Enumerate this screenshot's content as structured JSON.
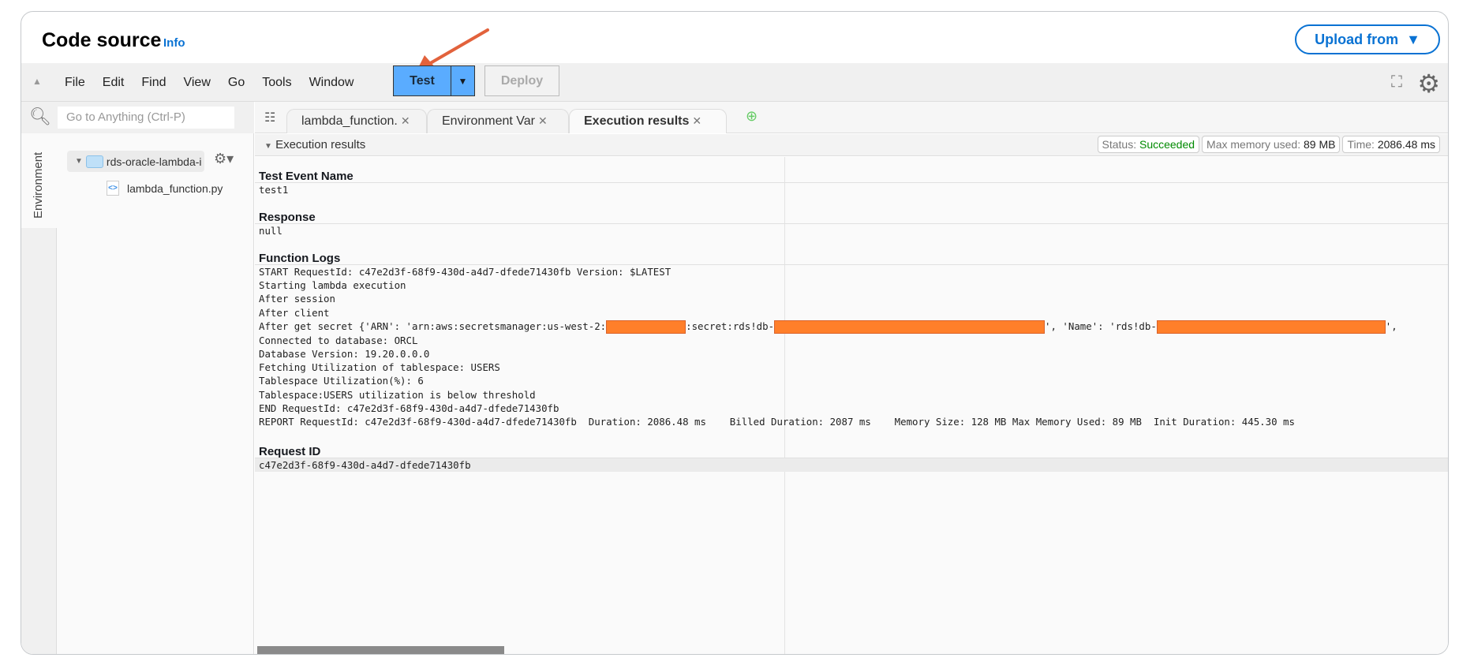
{
  "header": {
    "title": "Code source",
    "info": "Info",
    "upload": "Upload from",
    "upload_caret": "▼"
  },
  "toolbar": {
    "menu": [
      "File",
      "Edit",
      "Find",
      "View",
      "Go",
      "Tools",
      "Window"
    ],
    "test": "Test",
    "deploy": "Deploy"
  },
  "sidebar": {
    "search_placeholder": "Go to Anything (Ctrl-P)",
    "env_tab": "Environment",
    "folder": "rds-oracle-lambda-i",
    "file": "lambda_function.py"
  },
  "tabs": [
    {
      "label": "lambda_function."
    },
    {
      "label": "Environment Var"
    },
    {
      "label": "Execution results"
    }
  ],
  "results": {
    "title": "Execution results",
    "status_label": "Status:",
    "status": "Succeeded",
    "status_color": "#008a00",
    "memory_label": "Max memory used:",
    "memory": "89 MB",
    "time_label": "Time:",
    "time": "2086.48 ms",
    "test_event_name_label": "Test Event Name",
    "test_event_name": "test1",
    "response_label": "Response",
    "response": "null",
    "logs_label": "Function Logs",
    "logs_before": [
      "START RequestId: c47e2d3f-68f9-430d-a4d7-dfede71430fb Version: $LATEST",
      "Starting lambda execution",
      "After session",
      "After client"
    ],
    "secret_line": {
      "p1": "After get secret {'ARN': 'arn:aws:secretsmanager:us-west-2:",
      "p2": ":secret:rds!db-",
      "p3": "', 'Name': 'rds!db-",
      "p4": "',",
      "redaction_color": "#ff7f2a"
    },
    "logs_after": [
      "Connected to database: ORCL",
      "Database Version: 19.20.0.0.0",
      "Fetching Utilization of tablespace: USERS",
      "Tablespace Utilization(%): 6",
      "Tablespace:USERS utilization is below threshold",
      "END RequestId: c47e2d3f-68f9-430d-a4d7-dfede71430fb",
      "REPORT RequestId: c47e2d3f-68f9-430d-a4d7-dfede71430fb  Duration: 2086.48 ms    Billed Duration: 2087 ms    Memory Size: 128 MB Max Memory Used: 89 MB  Init Duration: 445.30 ms"
    ],
    "request_id_label": "Request ID",
    "request_id": "c47e2d3f-68f9-430d-a4d7-dfede71430fb"
  },
  "colors": {
    "test_button": "#5aacff",
    "accent": "#0972d3",
    "annotation_arrow": "#e2623c"
  }
}
